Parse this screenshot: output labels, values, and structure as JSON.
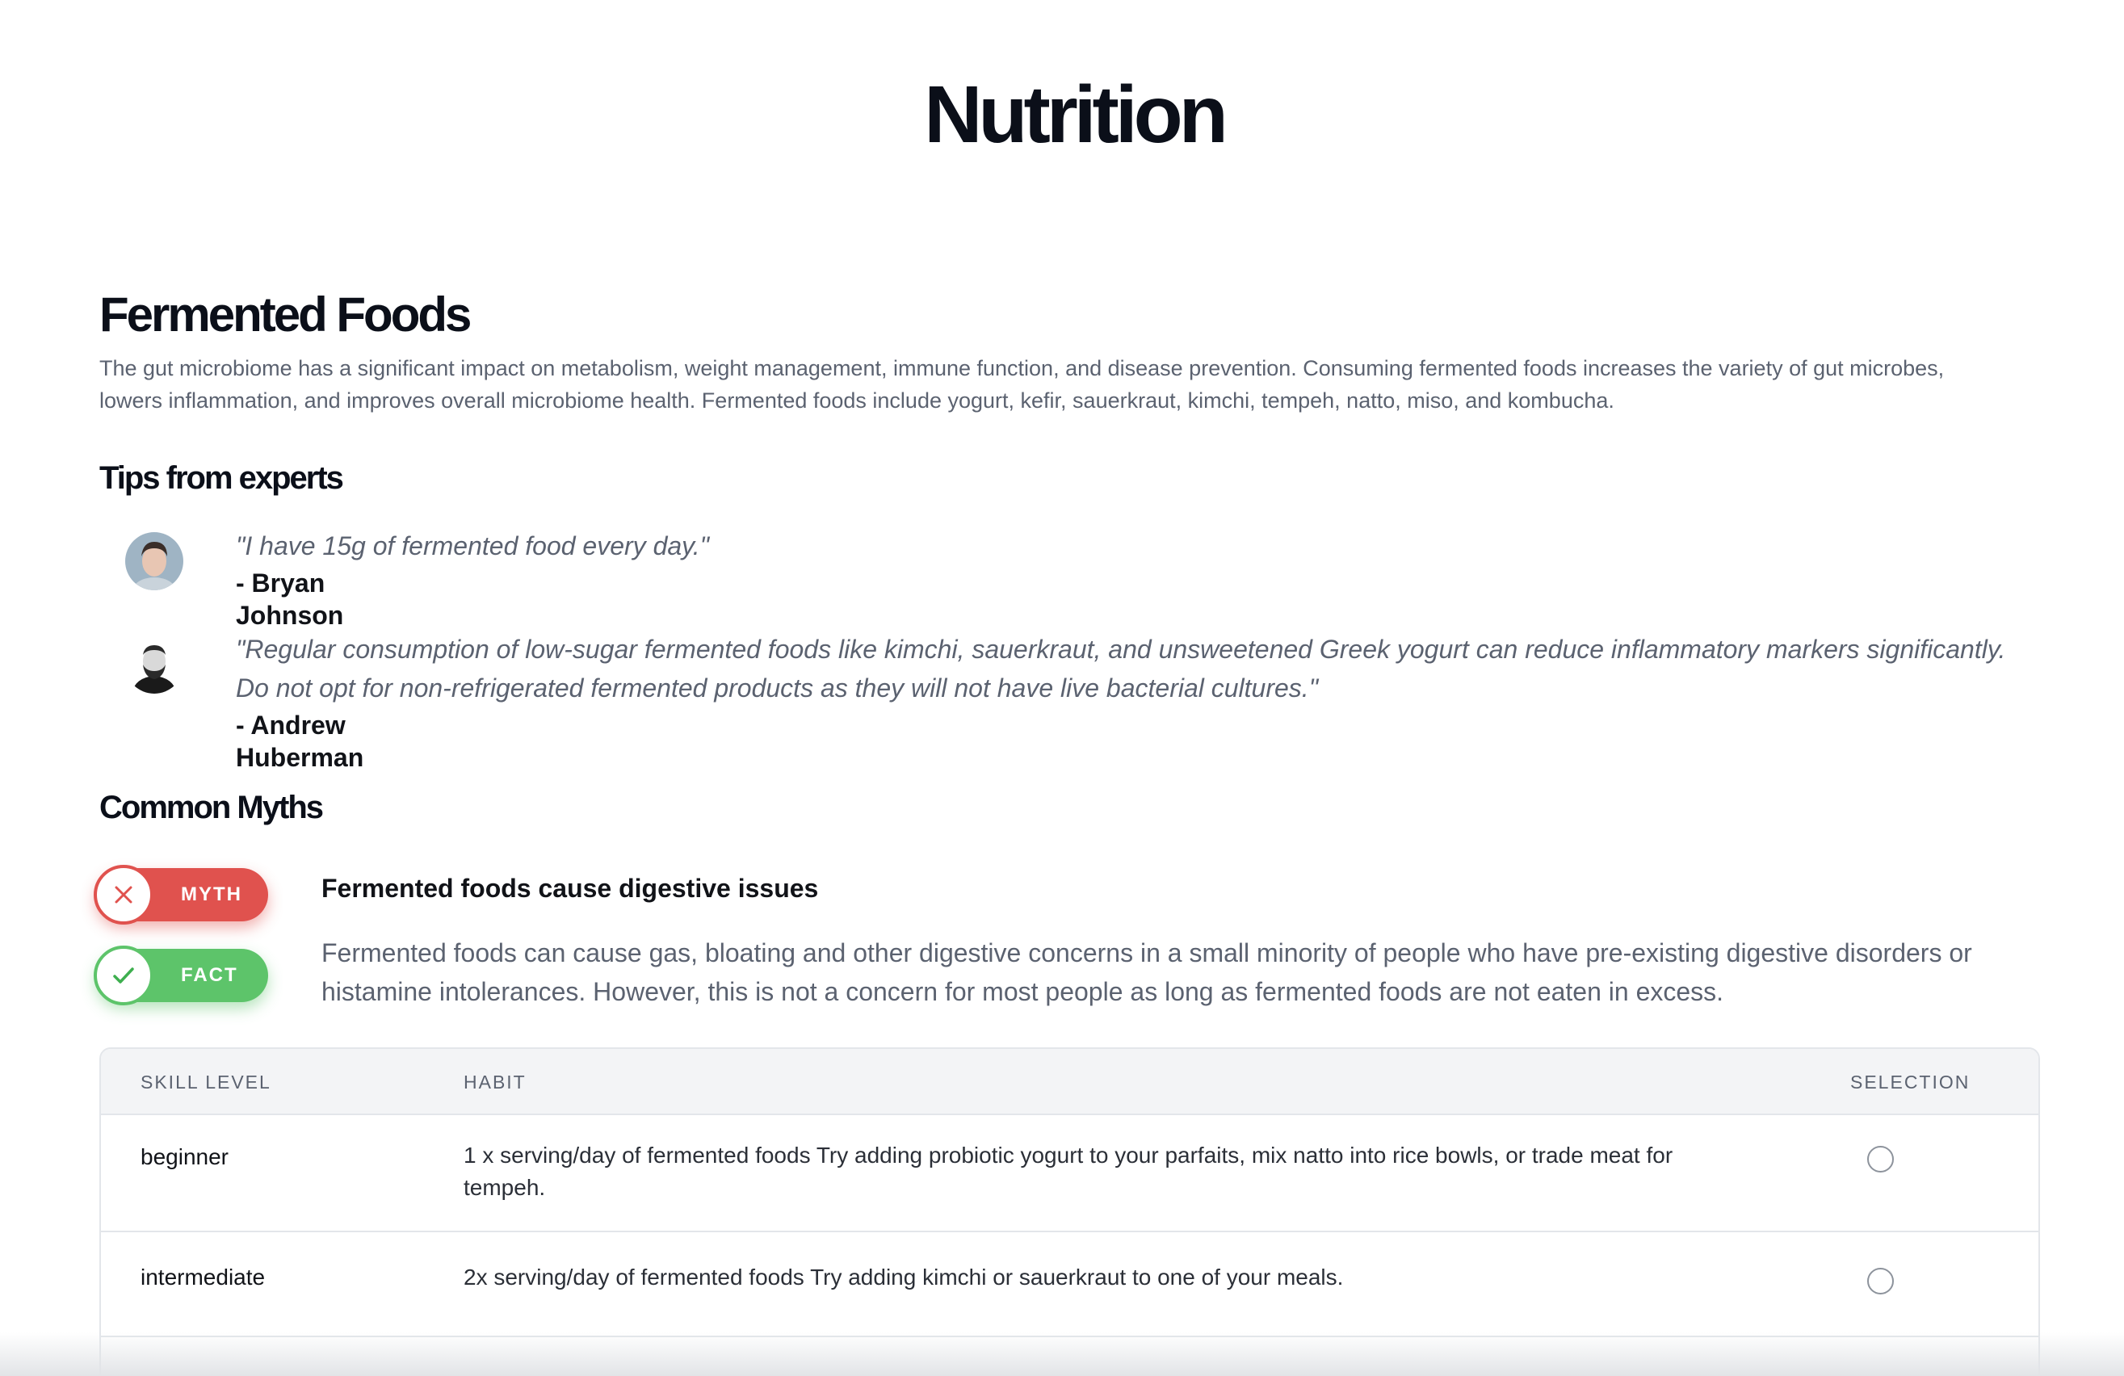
{
  "page": {
    "title": "Nutrition"
  },
  "section": {
    "title": "Fermented Foods",
    "intro": "The gut microbiome has a significant impact on metabolism, weight management, immune function, and disease prevention. Consuming fermented foods increases the variety of gut microbes, lowers inflammation, and improves overall microbiome health. Fermented foods include yogurt, kefir, sauerkraut, kimchi, tempeh, natto, miso, and kombucha."
  },
  "tips": {
    "heading": "Tips from experts",
    "items": [
      {
        "quote": "\"I have 15g of fermented food every day.\"",
        "author": "- Bryan Johnson",
        "avatar_icon": "person-avatar-icon"
      },
      {
        "quote": "\"Regular consumption of low-sugar fermented foods like kimchi, sauerkraut, and unsweetened Greek yogurt can reduce inflammatory markers significantly. Do not opt for non-refrigerated fermented products as they will not have live bacterial cultures.\"",
        "author": "- Andrew Huberman",
        "avatar_icon": "person-avatar-icon"
      }
    ]
  },
  "myths": {
    "heading": "Common Myths",
    "myth_label": "MYTH",
    "fact_label": "FACT",
    "myth_color": "#e0524e",
    "fact_color": "#5dc46a",
    "items": [
      {
        "claim": "Fermented foods cause digestive issues",
        "answer": "Fermented foods can cause gas, bloating and other digestive concerns in a small minority of people who have pre-existing digestive disorders or histamine intolerances. However, this is not a concern for most people as long as fermented foods are not eaten in excess."
      }
    ]
  },
  "habits_table": {
    "headers": {
      "level": "SKILL LEVEL",
      "habit": "HABIT",
      "selection": "SELECTION"
    },
    "rows": [
      {
        "level": "beginner",
        "habit": "1 x serving/day of fermented foods Try adding probiotic yogurt to your parfaits, mix natto into rice bowls, or trade meat for tempeh.",
        "selected": false
      },
      {
        "level": "intermediate",
        "habit": "2x serving/day of fermented foods Try adding kimchi or sauerkraut to one of your meals.",
        "selected": false
      }
    ]
  }
}
